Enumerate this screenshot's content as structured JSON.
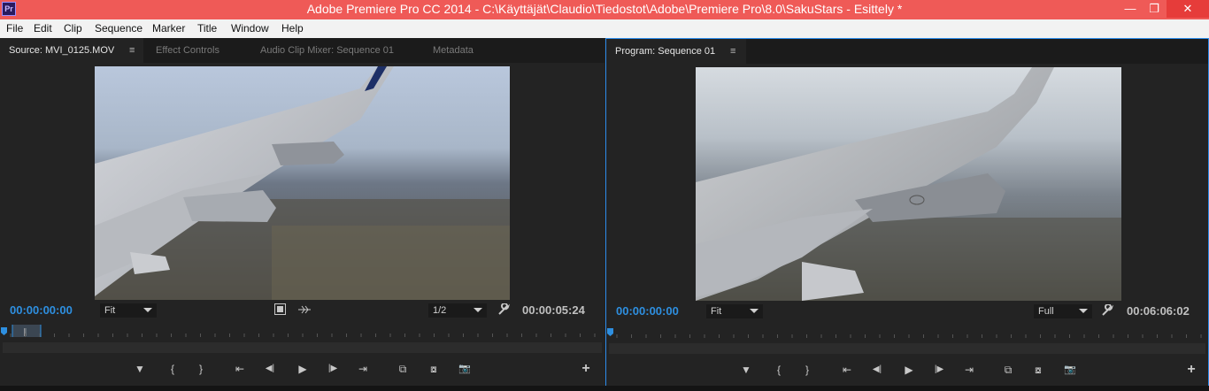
{
  "window": {
    "app_icon": "Pr",
    "title": "Adobe Premiere Pro CC 2014 - C:\\Käyttäjät\\Claudio\\Tiedostot\\Adobe\\Premiere Pro\\8.0\\SakuStars - Esittely *",
    "minimize": "—",
    "maximize": "❐",
    "close": "✕"
  },
  "menu": [
    "File",
    "Edit",
    "Clip",
    "Sequence",
    "Marker",
    "Title",
    "Window",
    "Help"
  ],
  "source_panel": {
    "tabs": [
      "Source: MVI_0125.MOV",
      "Effect Controls",
      "Audio Clip Mixer: Sequence 01",
      "Metadata"
    ],
    "active_tab": 0,
    "tab_menu_icon": "≡",
    "timecode_in": "00:00:00:00",
    "fit_value": "Fit",
    "resolution_value": "1/2",
    "duration": "00:00:05:24",
    "playhead_position": 0.0,
    "in_out_marker": "‖"
  },
  "program_panel": {
    "tabs": [
      "Program: Sequence 01"
    ],
    "active_tab": 0,
    "tab_menu_icon": "≡",
    "timecode_in": "00:00:00:00",
    "fit_value": "Fit",
    "resolution_value": "Full",
    "duration": "00:06:06:02",
    "playhead_position": 0.0
  },
  "transport": {
    "add_marker": "▼",
    "mark_in": "{",
    "mark_out": "}",
    "go_to_in": "⇤",
    "step_back": "◀|",
    "play": "▶",
    "step_forward": "|▶",
    "go_to_out": "⇥",
    "insert": "⧉",
    "overwrite": "⧇",
    "export_frame": "📷",
    "add_button": "+"
  },
  "icons": {
    "wrench": "wrench-icon",
    "film_strip": "film-strip-icon",
    "audio_waveform": "audio-waveform-icon"
  },
  "colors": {
    "accent_blue": "#2e8fe0",
    "title_bar": "#ef5a57",
    "panel_bg": "#232323"
  }
}
